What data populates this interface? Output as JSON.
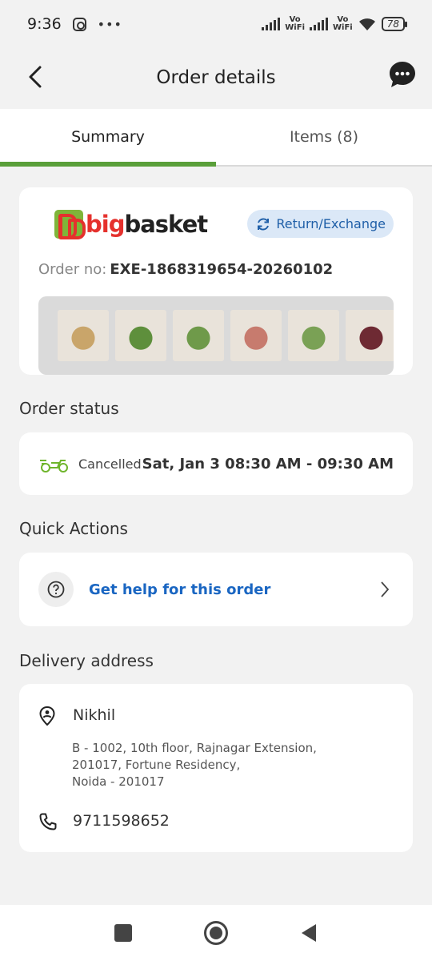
{
  "status_bar": {
    "time": "9:36",
    "vowifi_1": "Vo\nWiFi",
    "vowifi_2": "Vo\nWiFi",
    "battery": "78"
  },
  "header": {
    "title": "Order details"
  },
  "tabs": [
    {
      "label": "Summary",
      "active": true
    },
    {
      "label": "Items (8)",
      "active": false
    }
  ],
  "order": {
    "brand_big": "big",
    "brand_basket": "basket",
    "return_label": "Return/Exchange",
    "order_no_label": "Order no:",
    "order_no_value": "EXE-1868319654-20260102",
    "items": [
      {
        "name": "ginger",
        "color": "#c9a56a"
      },
      {
        "name": "coriander",
        "color": "#5e8f3c"
      },
      {
        "name": "beans",
        "color": "#6f9a4a"
      },
      {
        "name": "onions",
        "color": "#c77b6e"
      },
      {
        "name": "cucumber",
        "color": "#7aa155"
      },
      {
        "name": "beetroot",
        "color": "#6e2a33"
      }
    ]
  },
  "order_status": {
    "section_title": "Order status",
    "status": "Cancelled",
    "slot": "Sat, Jan 3 08:30 AM - 09:30 AM",
    "icon": "delivery-scooter-icon",
    "accent": "#6fb52c"
  },
  "quick_actions": {
    "section_title": "Quick Actions",
    "help_label": "Get help for this order"
  },
  "delivery": {
    "section_title": "Delivery address",
    "name": "Nikhil",
    "line1": "B - 1002, 10th floor, Rajnagar Extension,",
    "line2": "201017, Fortune Residency,",
    "line3": "Noida - 201017",
    "phone": "9711598652"
  },
  "colors": {
    "brand_green": "#5a9f3a",
    "link_blue": "#1a66c2",
    "brand_red": "#e5312d"
  }
}
